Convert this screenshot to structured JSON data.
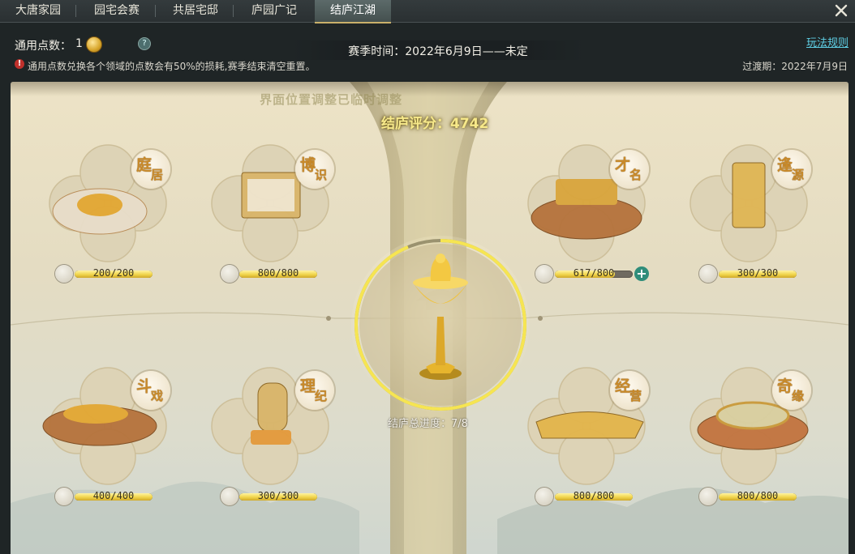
{
  "tabs": [
    {
      "label": "大唐家园",
      "active": false
    },
    {
      "label": "园宅会赛",
      "active": false
    },
    {
      "label": "共居宅邸",
      "active": false
    },
    {
      "label": "庐园广记",
      "active": false
    },
    {
      "label": "结庐江湖",
      "active": true
    }
  ],
  "header": {
    "points_label": "通用点数：",
    "points_value": "1",
    "season": "赛季时间：2022年6月9日——未定",
    "rules_link": "玩法规则",
    "warning": "通用点数兑换各个领域的点数会有50%的损耗,赛季结束清空重置。",
    "transition": "过渡期：2022年7月9日"
  },
  "main": {
    "ghost_text": "界面位置调整已临时调整",
    "score": "结庐评分：4742",
    "total_progress": "结庐总进度：7/8",
    "colors": {
      "gold": "#f0d44a",
      "accent": "#2f8d7a"
    }
  },
  "slots": [
    {
      "name": "庭居",
      "c1": "庭",
      "c2": "居",
      "progress": "200/200",
      "fraction": 1.0,
      "icon": "tree-icon"
    },
    {
      "name": "博识",
      "c1": "博",
      "c2": "识",
      "progress": "800/800",
      "fraction": 1.0,
      "icon": "book-icon"
    },
    {
      "name": "才名",
      "c1": "才",
      "c2": "名",
      "progress": "617/800",
      "fraction": 0.77,
      "icon": "fan-icon",
      "can_add": true
    },
    {
      "name": "逢源",
      "c1": "逢",
      "c2": "源",
      "progress": "300/300",
      "fraction": 1.0,
      "icon": "gift-icon"
    },
    {
      "name": "斗戏",
      "c1": "斗",
      "c2": "戏",
      "progress": "400/400",
      "fraction": 1.0,
      "icon": "scroll-icon"
    },
    {
      "name": "理纪",
      "c1": "理",
      "c2": "纪",
      "progress": "300/300",
      "fraction": 1.0,
      "icon": "jade-icon"
    },
    {
      "name": "经营",
      "c1": "经",
      "c2": "营",
      "progress": "800/800",
      "fraction": 1.0,
      "icon": "abacus-icon"
    },
    {
      "name": "奇缘",
      "c1": "奇",
      "c2": "缘",
      "progress": "800/800",
      "fraction": 1.0,
      "icon": "lotus-icon"
    }
  ]
}
